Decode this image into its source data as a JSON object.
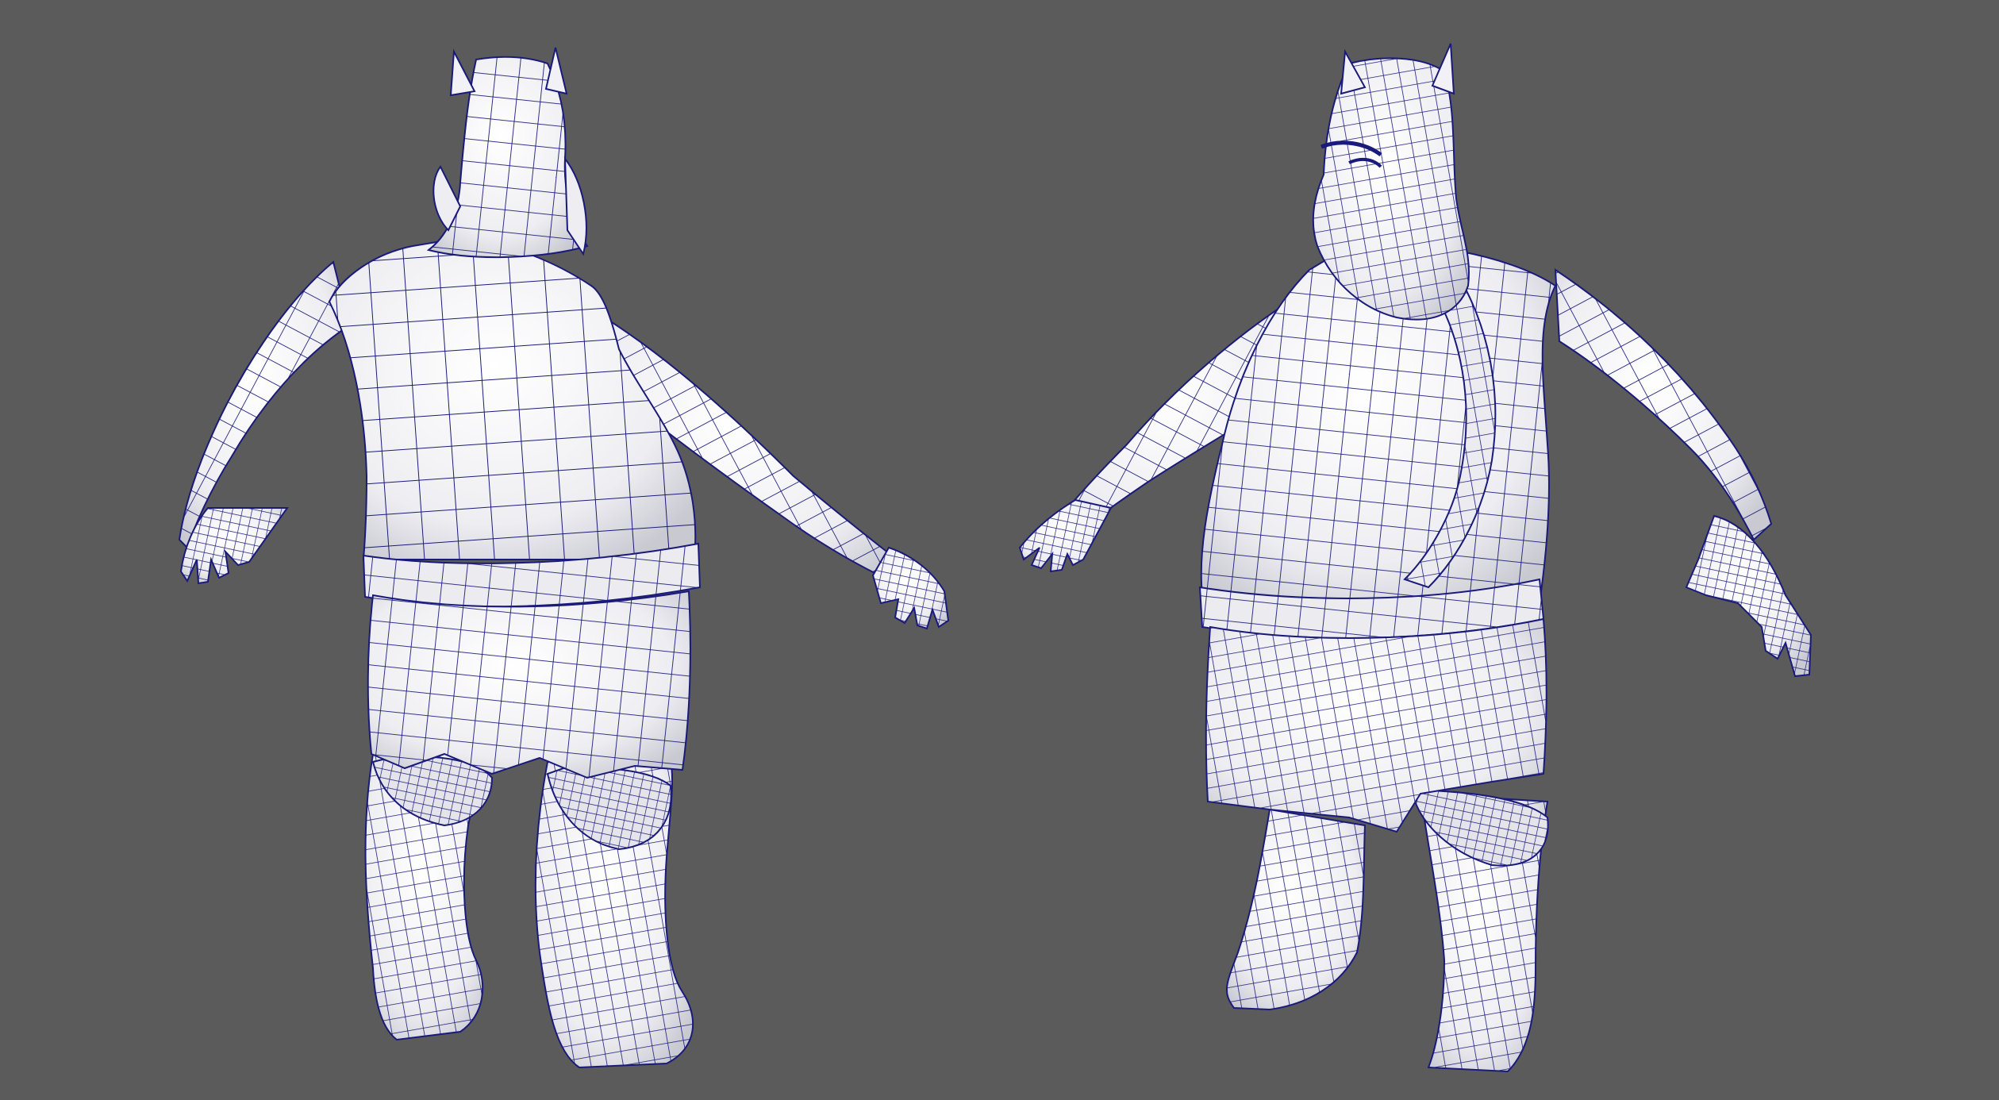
{
  "viewport": {
    "background_color": "#5b5b5b",
    "mesh_fill_color": "#f4f4f6",
    "wireframe_color": "#1a1a7a",
    "shade_color": "#d3d3da"
  },
  "models": [
    {
      "view": "back",
      "icon": "ogre-wireframe-back-icon"
    },
    {
      "view": "front",
      "icon": "ogre-wireframe-front-icon"
    }
  ]
}
